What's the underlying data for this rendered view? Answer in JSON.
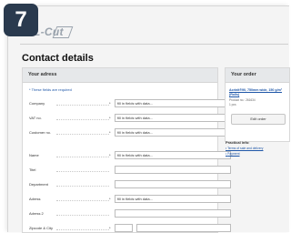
{
  "step_number": "7",
  "logo": {
    "text": "AL-Cut"
  },
  "page_title": "Contact details",
  "address_panel": {
    "heading": "Your adress",
    "required_note": "* These fields are required",
    "fields": [
      {
        "label": "Company",
        "required": "*",
        "value": "fill in fields with data..."
      },
      {
        "label": "VAT no.",
        "required": "*",
        "value": "fill in fields with data..."
      },
      {
        "label": "Customer no.",
        "required": "*",
        "value": "fill in fields with data..."
      },
      {
        "label": "Name",
        "required": "*",
        "value": "fill in fields with data..."
      },
      {
        "label": "Titel",
        "required": "",
        "value": ""
      },
      {
        "label": "Department",
        "required": "",
        "value": ""
      },
      {
        "label": "Adress",
        "required": "*",
        "value": "fill in fields with data..."
      },
      {
        "label": "Adress 2",
        "required": "",
        "value": ""
      },
      {
        "label": "Zipcode & City",
        "required": "*",
        "value": ""
      }
    ]
  },
  "order_panel": {
    "heading": "Your order",
    "product_name": "Acrinit®90, 750mm wide, 150 g/m² (Rolls)",
    "product_no": "Product no.: 261634",
    "quantity": "1 pcs",
    "edit_button": "Edit order"
  },
  "practical_info": {
    "heading": "Practical info:",
    "links": [
      "Terms of sale and delivery",
      "Payment"
    ]
  }
}
